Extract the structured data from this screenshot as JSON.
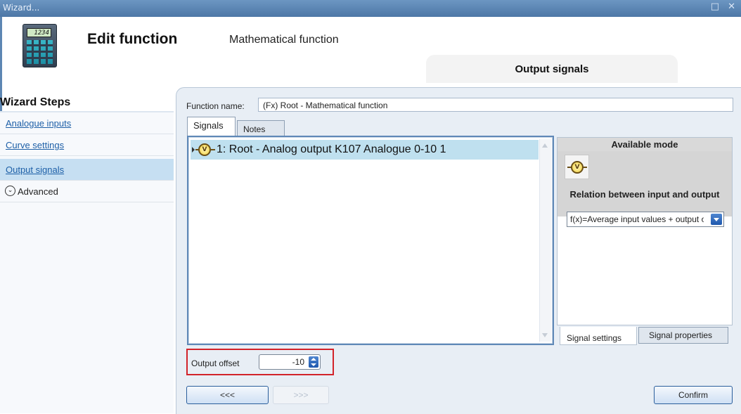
{
  "window": {
    "title": "Wizard...",
    "controls": "□ ✕"
  },
  "header": {
    "icon_display": "1234",
    "title": "Edit function",
    "subtitle": "Mathematical function",
    "active_tab": "Output signals"
  },
  "wizard_steps": {
    "title": "Wizard Steps",
    "items": [
      {
        "label": "Analogue inputs",
        "selected": false
      },
      {
        "label": "Curve settings",
        "selected": false
      },
      {
        "label": "Output signals",
        "selected": true
      }
    ],
    "advanced": {
      "label": "Advanced",
      "icon": "chevron-down-icon"
    }
  },
  "function_name": {
    "label": "Function name:",
    "value": "(Fx) Root - Mathematical function"
  },
  "tabs": {
    "signals": "Signals",
    "notes": "Notes"
  },
  "signals": [
    {
      "index_label": "1: Root - Analog output K107 Analogue 0-10 1",
      "icon": "V"
    }
  ],
  "mode_panel": {
    "header": "Available mode",
    "mode_icon": "V",
    "relation_label": "Relation between input and output",
    "relation_value": "f(x)=Average input values + output offset",
    "tabs": {
      "settings": "Signal settings",
      "properties": "Signal properties"
    }
  },
  "output_offset": {
    "label": "Output offset",
    "value": "-10"
  },
  "buttons": {
    "back": "<<<",
    "next": ">>>",
    "confirm": "Confirm"
  },
  "colors": {
    "titlebar": "#5b86b6",
    "selection": "#bfe0ef",
    "highlight_box": "#d2232a",
    "link": "#1d5fa7"
  }
}
